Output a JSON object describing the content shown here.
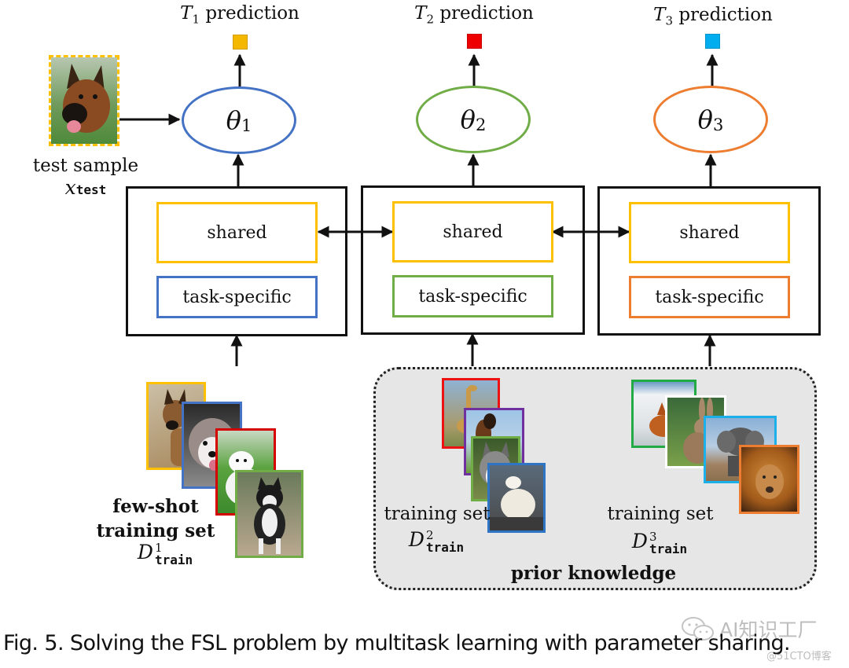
{
  "figure": {
    "predictions": [
      {
        "task": "T",
        "index": "1",
        "label": "prediction",
        "color": "#f5b800"
      },
      {
        "task": "T",
        "index": "2",
        "label": "prediction",
        "color": "#ee0000"
      },
      {
        "task": "T",
        "index": "3",
        "label": "prediction",
        "color": "#00aeef"
      }
    ],
    "models": [
      {
        "symbol": "θ",
        "index": "1",
        "color": "#4472c4"
      },
      {
        "symbol": "θ",
        "index": "2",
        "color": "#70ad47"
      },
      {
        "symbol": "θ",
        "index": "3",
        "color": "#ed7d31"
      }
    ],
    "task_modules": [
      {
        "shared_label": "shared",
        "shared_color": "#ffc000",
        "specific_label": "task-specific",
        "specific_color": "#4472c4"
      },
      {
        "shared_label": "shared",
        "shared_color": "#ffc000",
        "specific_label": "task-specific",
        "specific_color": "#70ad47"
      },
      {
        "shared_label": "shared",
        "shared_color": "#ffc000",
        "specific_label": "task-specific",
        "specific_color": "#ed7d31"
      }
    ],
    "test_sample": {
      "label": "test sample",
      "math_var": "x",
      "math_sub": "test",
      "image": "german-shepherd-photo",
      "border_color": "#ffc000"
    },
    "few_shot_set": {
      "line1": "few-shot",
      "line2": "training set",
      "math_var": "D",
      "math_sup": "1",
      "math_sub": "train",
      "images": [
        {
          "subject": "german-shepherd",
          "border": "#ffc000"
        },
        {
          "subject": "malamute-puppy",
          "border": "#4472c4"
        },
        {
          "subject": "samoyed-puppy",
          "border": "#d40000"
        },
        {
          "subject": "alaskan-malamute",
          "border": "#70ad47"
        }
      ]
    },
    "prior_knowledge": {
      "label": "prior knowledge",
      "sets": [
        {
          "label": "training set",
          "math_var": "D",
          "math_sup": "2",
          "math_sub": "train",
          "images": [
            {
              "subject": "giraffe",
              "border": "#ee1111"
            },
            {
              "subject": "horse",
              "border": "#7030a0"
            },
            {
              "subject": "husky",
              "border": "#70ad47"
            },
            {
              "subject": "polar-bear",
              "border": "#2e75c6"
            }
          ]
        },
        {
          "label": "training set",
          "math_var": "D",
          "math_sup": "3",
          "math_sub": "train",
          "images": [
            {
              "subject": "fox",
              "border": "#22aa44"
            },
            {
              "subject": "rabbit",
              "border": "#ffffff"
            },
            {
              "subject": "elephant",
              "border": "#1cb0ea"
            },
            {
              "subject": "lion",
              "border": "#ed7d31"
            }
          ]
        }
      ]
    }
  },
  "caption": "Fig. 5.  Solving the FSL problem by multitask learning with parameter sharing.",
  "watermark": {
    "main": "AI知识工厂",
    "sub": "@51CTO博客"
  }
}
